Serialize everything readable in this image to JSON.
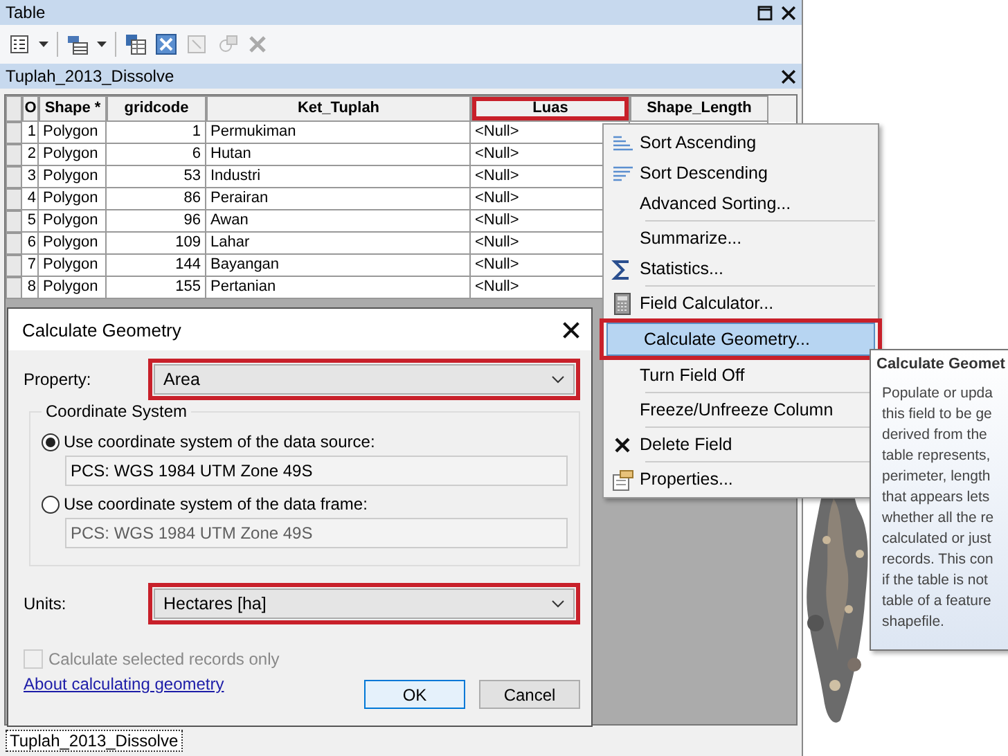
{
  "table_window": {
    "title": "Table"
  },
  "table": {
    "title": "Tuplah_2013_Dissolve",
    "columns": [
      {
        "label": "O",
        "highlighted": false
      },
      {
        "label": "Shape *",
        "highlighted": false
      },
      {
        "label": "gridcode",
        "highlighted": false
      },
      {
        "label": "Ket_Tuplah",
        "highlighted": false
      },
      {
        "label": "Luas",
        "highlighted": true
      },
      {
        "label": "Shape_Length",
        "highlighted": false
      }
    ],
    "rows": [
      [
        "1",
        "Polygon",
        "1",
        "Permukiman",
        "<Null>"
      ],
      [
        "2",
        "Polygon",
        "6",
        "Hutan",
        "<Null>"
      ],
      [
        "3",
        "Polygon",
        "53",
        "Industri",
        "<Null>"
      ],
      [
        "4",
        "Polygon",
        "86",
        "Perairan",
        "<Null>"
      ],
      [
        "5",
        "Polygon",
        "96",
        "Awan",
        "<Null>"
      ],
      [
        "6",
        "Polygon",
        "109",
        "Lahar",
        "<Null>"
      ],
      [
        "7",
        "Polygon",
        "144",
        "Bayangan",
        "<Null>"
      ],
      [
        "8",
        "Polygon",
        "155",
        "Pertanian",
        "<Null>"
      ]
    ]
  },
  "bottom_tab": "Tuplah_2013_Dissolve",
  "context_menu": {
    "items": [
      {
        "kind": "item",
        "label": "Sort Ascending",
        "selected": false,
        "highlighted": false
      },
      {
        "kind": "item",
        "label": "Sort Descending",
        "selected": false,
        "highlighted": false
      },
      {
        "kind": "item",
        "label": "Advanced Sorting...",
        "selected": false,
        "highlighted": false
      },
      {
        "kind": "separator"
      },
      {
        "kind": "item",
        "label": "Summarize...",
        "selected": false,
        "highlighted": false
      },
      {
        "kind": "item",
        "label": "Statistics...",
        "selected": false,
        "highlighted": false
      },
      {
        "kind": "separator"
      },
      {
        "kind": "item",
        "label": "Field Calculator...",
        "selected": false,
        "highlighted": false
      },
      {
        "kind": "item",
        "label": "Calculate Geometry...",
        "selected": true,
        "highlighted": true
      },
      {
        "kind": "item",
        "label": "Turn Field Off",
        "selected": false,
        "highlighted": false
      },
      {
        "kind": "separator"
      },
      {
        "kind": "item",
        "label": "Freeze/Unfreeze Column",
        "selected": false,
        "highlighted": false
      },
      {
        "kind": "separator"
      },
      {
        "kind": "item",
        "label": "Delete Field",
        "selected": false,
        "highlighted": false
      },
      {
        "kind": "separator"
      },
      {
        "kind": "item",
        "label": "Properties...",
        "selected": false,
        "highlighted": false
      }
    ]
  },
  "tooltip": {
    "title": "Calculate Geomet",
    "lines": [
      "Populate or upda",
      "this field to be ge",
      "derived from the",
      "table represents,",
      "perimeter, length",
      "that appears lets",
      "whether all the re",
      "calculated or just",
      "records. This con",
      "if the table is not",
      "table of a feature",
      "shapefile."
    ]
  },
  "dialog": {
    "title": "Calculate Geometry",
    "property": {
      "label": "Property:",
      "value": "Area",
      "highlighted": true
    },
    "coordinate_system": {
      "label": "Coordinate System",
      "options": [
        {
          "label": "Use coordinate system of the data source:",
          "selected": true,
          "value": "PCS: WGS 1984 UTM Zone 49S",
          "disabled": false
        },
        {
          "label": "Use coordinate system of the data frame:",
          "selected": false,
          "value": "PCS: WGS 1984 UTM Zone 49S",
          "disabled": true
        }
      ]
    },
    "units": {
      "label": "Units:",
      "value": "Hectares [ha]",
      "highlighted": true
    },
    "selected_only": {
      "label": "Calculate selected records only",
      "checked": false,
      "disabled": true
    },
    "help_link": "About calculating geometry",
    "buttons": [
      {
        "label": "OK",
        "default": true
      },
      {
        "label": "Cancel",
        "default": false
      }
    ]
  }
}
